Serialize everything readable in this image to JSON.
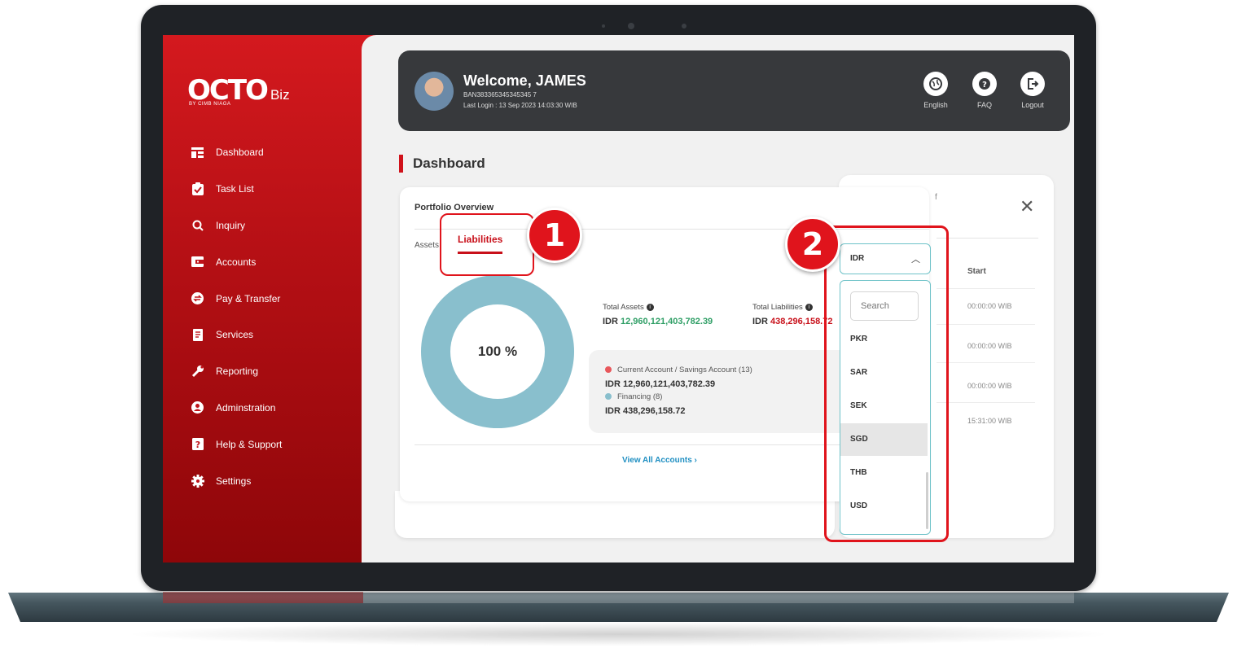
{
  "brand": {
    "logo_main": "OCTO",
    "logo_sub": "Biz",
    "logo_by": "BY CIMB NIAGA"
  },
  "sidebar": {
    "items": [
      {
        "label": "Dashboard",
        "icon": "dashboard-icon"
      },
      {
        "label": "Task List",
        "icon": "checklist-icon"
      },
      {
        "label": "Inquiry",
        "icon": "search-icon"
      },
      {
        "label": "Accounts",
        "icon": "wallet-icon"
      },
      {
        "label": "Pay & Transfer",
        "icon": "transfer-icon"
      },
      {
        "label": "Services",
        "icon": "document-icon"
      },
      {
        "label": "Reporting",
        "icon": "wrench-icon"
      },
      {
        "label": "Adminstration",
        "icon": "user-circle-icon"
      },
      {
        "label": "Help & Support",
        "icon": "help-icon"
      },
      {
        "label": "Settings",
        "icon": "gear-icon"
      }
    ]
  },
  "header": {
    "welcome": "Welcome, JAMES",
    "account_number": "BAN383365345345345 7",
    "last_login": "Last Login : 13 Sep 2023 14:03:30 WIB",
    "buttons": [
      {
        "label": "English",
        "icon": "globe-icon"
      },
      {
        "label": "FAQ",
        "icon": "question-icon"
      },
      {
        "label": "Logout",
        "icon": "logout-icon"
      }
    ]
  },
  "page": {
    "title": "Dashboard"
  },
  "portfolio": {
    "title": "Portfolio Overview",
    "tabs": {
      "assets": "Assets",
      "liabilities": "Liabilities"
    },
    "donut_percent": "100 %",
    "total_assets_label": "Total Assets",
    "total_assets_currency": "IDR",
    "total_assets_value": "12,960,121,403,782.39",
    "total_liabilities_label": "Total Liabilities",
    "total_liabilities_currency": "IDR",
    "total_liabilities_value": "438,296,158.72",
    "breakdown": [
      {
        "label": "Current Account / Savings Account (13)",
        "amount": "IDR 12,960,121,403,782.39",
        "color": "#e8575b"
      },
      {
        "label": "Financing (8)",
        "amount": "IDR 438,296,158.72",
        "color": "#89bfcd"
      }
    ],
    "view_all": "View All Accounts ›"
  },
  "currency_select": {
    "value": "IDR",
    "search_placeholder": "Search",
    "options": [
      "PKR",
      "SAR",
      "SEK",
      "SGD",
      "THB",
      "USD"
    ],
    "highlighted": "SGD"
  },
  "background_panel": {
    "column_header": "Start",
    "times": [
      "00:00:00 WIB",
      "00:00:00 WIB",
      "00:00:00 WIB",
      "15:31:00 WIB"
    ]
  },
  "callouts": [
    "1",
    "2"
  ],
  "colors": {
    "brand_red": "#d0121b",
    "header_bg": "#37393c",
    "donut": "#89bfcd",
    "asset_green": "#2e9e65",
    "accent_teal": "#6ec2c8"
  }
}
